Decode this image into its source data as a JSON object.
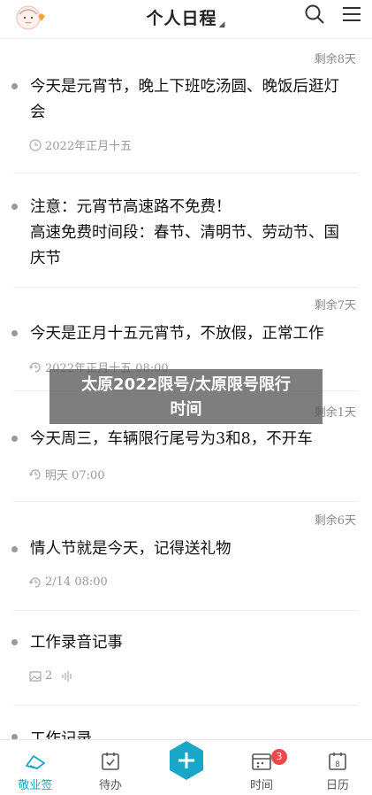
{
  "header": {
    "title": "个人日程"
  },
  "items": [
    {
      "remain": "剩余8天",
      "text": "今天是元宵节，晚上下班吃汤圆、晚饭后逛灯会",
      "meta": "2022年正月十五",
      "meta_icon": "clock-icon"
    },
    {
      "remain": "",
      "text": "注意：元宵节高速路不免费！\n高速免费时间段：春节、清明节、劳动节、国庆节",
      "meta": "",
      "meta_icon": ""
    },
    {
      "remain": "剩余7天",
      "text": "今天是正月十五元宵节，不放假，正常工作",
      "meta": "2022年正月十五 08:00",
      "meta_icon": "repeat-clock-icon"
    },
    {
      "remain": "剩余1天",
      "text": "今天周三，车辆限行尾号为3和8，不开车",
      "meta": "明天 07:00",
      "meta_icon": "repeat-clock-icon"
    },
    {
      "remain": "剩余6天",
      "text": "情人节就是今天，记得送礼物",
      "meta": "2/14 08:00",
      "meta_icon": "repeat-clock-icon"
    },
    {
      "remain": "",
      "text": "工作录音记事",
      "meta": "2",
      "meta_icon": "image-icon"
    },
    {
      "remain": "",
      "text": "工作记录",
      "meta": "",
      "meta_icon": ""
    }
  ],
  "banner": {
    "line1": "太原2022限号/太原限号限行",
    "line2": "时间"
  },
  "tabbar": {
    "tabs": [
      {
        "label": "敬业签",
        "icon": "sign-icon",
        "active": true
      },
      {
        "label": "待办",
        "icon": "todo-icon",
        "active": false
      },
      {
        "label": "",
        "icon": "plus-icon",
        "active": false
      },
      {
        "label": "时间",
        "icon": "time-icon",
        "active": false
      },
      {
        "label": "日历",
        "icon": "calendar-icon",
        "active": false
      }
    ],
    "time_badge": "3"
  },
  "colors": {
    "accent": "#19a6c8",
    "badge": "#e84b4b",
    "meta_gray": "#999999"
  }
}
